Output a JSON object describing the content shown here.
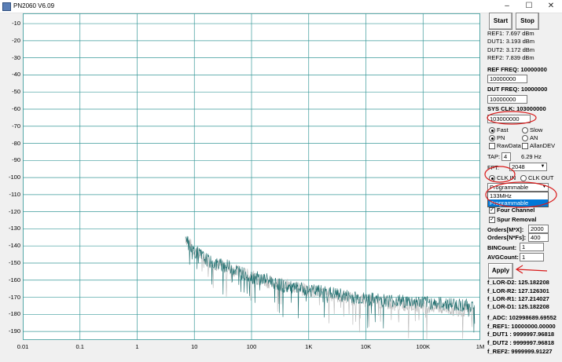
{
  "window": {
    "title": "PN2060 V6.09",
    "minimize": "–",
    "maximize": "☐",
    "close": "✕"
  },
  "chart_data": {
    "type": "line",
    "xscale": "log",
    "xlim": [
      0.01,
      1000000
    ],
    "ylim": [
      -195,
      -4
    ],
    "y_ticks": [
      "-10",
      "-20",
      "-30",
      "-40",
      "-50",
      "-60",
      "-70",
      "-80",
      "-90",
      "-100",
      "-110",
      "-120",
      "-130",
      "-140",
      "-150",
      "-160",
      "-170",
      "-180",
      "-190"
    ],
    "x_ticks": [
      "0.01",
      "0.1",
      "1",
      "10",
      "100",
      "1K",
      "10K",
      "100K",
      "1M"
    ],
    "grid": true,
    "series": [
      {
        "color": "#1e6e6e",
        "x": [
          7,
          8,
          10,
          15,
          20,
          40,
          70,
          100,
          200,
          400,
          1000,
          2000,
          4000,
          10000,
          30000,
          100000,
          300000,
          800000
        ],
        "y": [
          -133,
          -140,
          -143,
          -147,
          -150,
          -152,
          -156,
          -158,
          -160,
          -164,
          -166,
          -167,
          -169,
          -171,
          -172,
          -173,
          -174,
          -175
        ]
      },
      {
        "color": "#b8b8b8",
        "x": [
          7,
          10,
          20,
          40,
          100,
          200,
          400,
          1000,
          4000,
          10000,
          30000,
          100000,
          300000,
          800000
        ],
        "y": [
          -135,
          -143,
          -150,
          -153,
          -158,
          -161,
          -163,
          -166,
          -170,
          -172,
          -174,
          -175,
          -177,
          -178
        ]
      }
    ]
  },
  "panel": {
    "start": "Start",
    "stop": "Stop",
    "ref1": "REF1: 7.697 dBm",
    "dut1": "DUT1: 3.193 dBm",
    "dut2": "DUT2: 3.172 dBm",
    "ref2": "REF2: 7.839 dBm",
    "ref_freq_label": "REF FREQ: 10000000",
    "ref_freq_value": "10000000",
    "dut_freq_label": "DUT FREQ: 10000000",
    "dut_freq_value": "10000000",
    "sys_clk_label": "SYS CLK: 103000000",
    "sys_clk_value": "103000000",
    "fast": "Fast",
    "slow": "Slow",
    "pn": "PN",
    "an": "AN",
    "rawdata": "RawData",
    "allandev": "AllanDEV",
    "tap_label": "TAP:",
    "tap_value": "4",
    "tap_hz": "6.29 Hz",
    "fft_label": "FFT:",
    "fft_value": "2048",
    "clk_in": "CLK IN",
    "clk_out": "CLK OUT",
    "clk_select_value": "Programmable",
    "clk_options": [
      "133MHz",
      "Programmable"
    ],
    "four_channel": "Four Channel",
    "spur_removal": "Spur Removal",
    "orders_m_label": "Orders[M*X]:",
    "orders_m_value": "2000",
    "orders_n_label": "Orders[N*Fs]:",
    "orders_n_value": "400",
    "bincount_label": "BINCount:",
    "bincount_value": "1",
    "avgcount_label": "AVGCount:",
    "avgcount_value": "1",
    "apply": "Apply",
    "f_lor_d2": "f_LOR-D2: 125.182208",
    "f_lor_r2": "f_LOR-R2: 127.126301",
    "f_lor_r1": "f_LOR-R1: 127.214027",
    "f_lor_d1": "f_LOR-D1: 125.182208",
    "f_adc": "f_ADC: 102998689.69552",
    "f_ref1": "f_REF1: 10000000.00000",
    "f_dut1": "f_DUT1 : 9999997.96818",
    "f_dut2": "f_DUT2 : 9999997.96818",
    "f_ref2": "f_REF2: 9999999.91227"
  }
}
